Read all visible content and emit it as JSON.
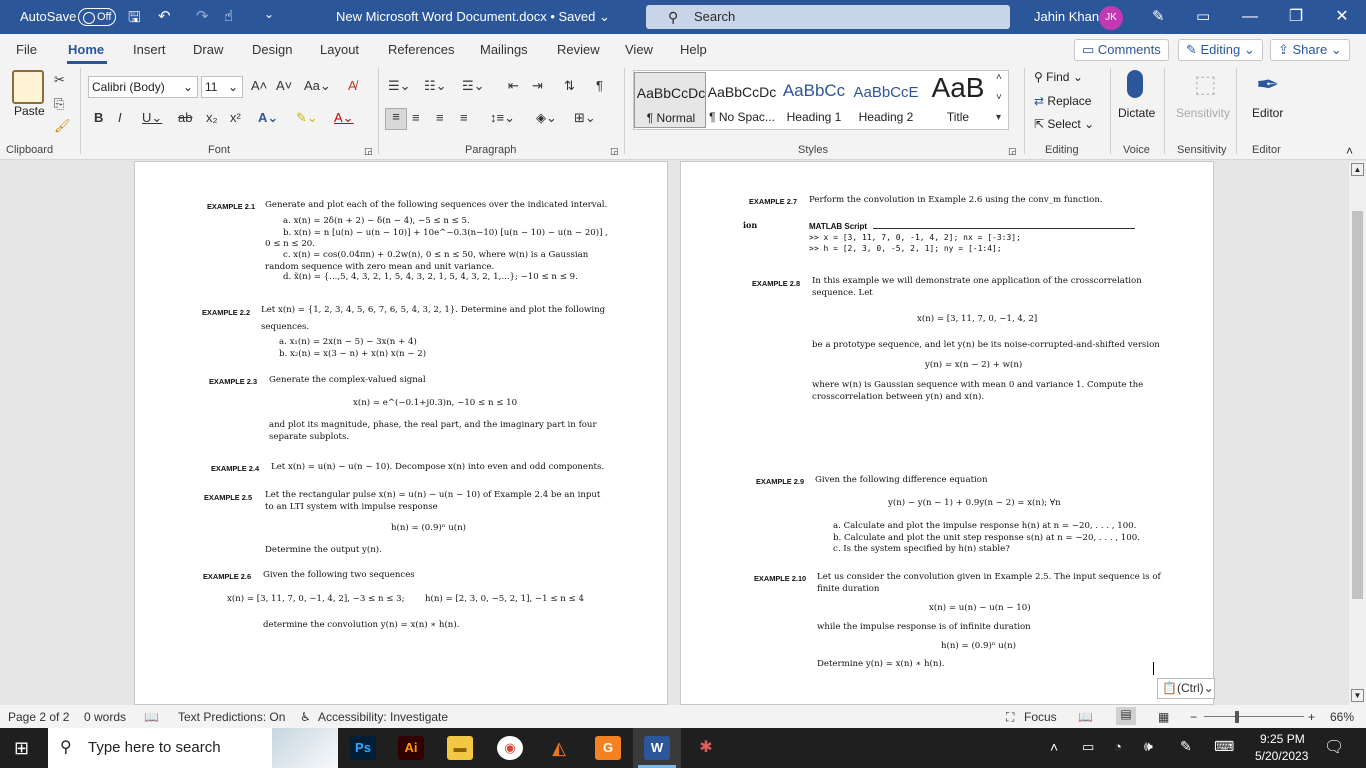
{
  "titlebar": {
    "autosave": "AutoSave",
    "toggle": "Off",
    "doc_title": "New Microsoft Word Document.docx • Saved",
    "search": "Search",
    "user": "Jahin Khan",
    "initials": "JK"
  },
  "menu": {
    "tabs": [
      "File",
      "Home",
      "Insert",
      "Draw",
      "Design",
      "Layout",
      "References",
      "Mailings",
      "Review",
      "View",
      "Help"
    ],
    "comments": "Comments",
    "editing": "Editing",
    "share": "Share"
  },
  "ribbon": {
    "paste": "Paste",
    "font_name": "Calibri (Body)",
    "font_size": "11",
    "styles": [
      {
        "sample": "AaBbCcDc",
        "name": "¶ Normal"
      },
      {
        "sample": "AaBbCcDc",
        "name": "¶ No Spac..."
      },
      {
        "sample": "AaBbCc",
        "name": "Heading 1"
      },
      {
        "sample": "AaBbCcE",
        "name": "Heading 2"
      },
      {
        "sample": "AaB",
        "name": "Title"
      }
    ],
    "find": "Find",
    "replace": "Replace",
    "select": "Select",
    "dictate": "Dictate",
    "sensitivity": "Sensitivity",
    "editor": "Editor",
    "groups": {
      "clipboard": "Clipboard",
      "font": "Font",
      "paragraph": "Paragraph",
      "styles": "Styles",
      "editing": "Editing",
      "voice": "Voice",
      "sensitivity": "Sensitivity",
      "editor": "Editor"
    }
  },
  "page1": {
    "ex21": {
      "label": "EXAMPLE 2.1",
      "text": "Generate and plot each of the following sequences over the indicated interval.",
      "a": "a.  x(n) = 2δ(n + 2) − δ(n − 4),   −5 ≤ n ≤ 5.",
      "b": "b.  x(n) = n [u(n) − u(n − 10)] + 10e^−0.3(n−10) [u(n − 10) − u(n − 20)] ,",
      "b2": "0 ≤ n ≤ 20.",
      "c": "c.  x(n) = cos(0.04πn) + 0.2w(n),  0 ≤ n ≤ 50,  where w(n) is a Gaussian",
      "c2": "random sequence with zero mean and unit variance.",
      "d": "d.  x̃(n) = {...,5, 4, 3, 2, 1, 5, 4, 3, 2, 1, 5, 4, 3, 2, 1,...};  −10 ≤ n ≤ 9."
    },
    "ex22": {
      "label": "EXAMPLE 2.2",
      "text": "Let x(n) = {1, 2, 3, 4, 5, 6, 7, 6, 5, 4, 3, 2, 1}.  Determine and plot the following",
      "text2": "sequences.",
      "a": "a.  x₁(n) = 2x(n − 5) − 3x(n + 4)",
      "b": "b.  x₂(n) = x(3 − n) + x(n) x(n − 2)"
    },
    "ex23": {
      "label": "EXAMPLE 2.3",
      "text": "Generate the complex-valued signal",
      "eq": "x(n) = e^(−0.1+j0.3)n,   −10 ≤ n ≤ 10",
      "t2": "and plot its magnitude, phase, the real part, and the imaginary part in four",
      "t3": "separate subplots."
    },
    "ex24": {
      "label": "EXAMPLE 2.4",
      "text": "Let x(n) = u(n) − u(n − 10).  Decompose x(n) into even and odd components."
    },
    "ex25": {
      "label": "EXAMPLE 2.5",
      "text": "Let the rectangular pulse x(n) = u(n) − u(n − 10) of Example 2.4 be an input",
      "text2": "to an LTI system with impulse response",
      "eq": "h(n) = (0.9)ⁿ u(n)",
      "t3": "Determine the output y(n)."
    },
    "ex26": {
      "label": "EXAMPLE 2.6",
      "text": "Given the following two sequences",
      "eq1": "x(n) = [3, 11, 7, 0, −1, 4, 2],   −3 ≤ n ≤ 3;",
      "eq2": "h(n) = [2, 3, 0, −5, 2, 1],   −1 ≤ n ≤ 4",
      "t3": "determine the convolution y(n) = x(n) ∗ h(n)."
    }
  },
  "page2": {
    "ex27": {
      "label": "EXAMPLE 2.7",
      "text": "Perform the convolution in Example 2.6 using the conv_m function.",
      "side": "ion",
      "script": "MATLAB Script",
      "l1": ">> x = [3, 11, 7, 0, -1, 4, 2]; nx = [-3:3];",
      "l2": ">> h = [2, 3, 0, -5, 2, 1]; ny = [-1:4];"
    },
    "ex28": {
      "label": "EXAMPLE 2.8",
      "text": "In this example we will demonstrate one application of the crosscorrelation",
      "text2": "sequence. Let",
      "eq": "x(n) = [3, 11, 7, 0, −1, 4, 2]",
      "t3": "be a prototype sequence, and let y(n) be its noise-corrupted-and-shifted version",
      "eq2": "y(n) = x(n − 2) + w(n)",
      "t4": "where w(n) is Gaussian sequence with mean 0 and variance 1.  Compute the",
      "t5": "crosscorrelation between y(n) and x(n)."
    },
    "ex29": {
      "label": "EXAMPLE 2.9",
      "text": "Given the following difference equation",
      "eq": "y(n) − y(n − 1) + 0.9y(n − 2) = x(n);   ∀n",
      "a": "a.  Calculate and plot the impulse response h(n) at n = −20, . . . , 100.",
      "b": "b.  Calculate and plot the unit step response s(n) at n = −20, . . . , 100.",
      "c": "c.  Is the system specified by h(n) stable?"
    },
    "ex210": {
      "label": "EXAMPLE 2.10",
      "text": "Let us consider the convolution given in Example 2.5.  The input sequence is of",
      "text2": "finite duration",
      "eq": "x(n) = u(n) − u(n − 10)",
      "t3": "while the impulse response is of infinite duration",
      "eq2": "h(n) = (0.9)ⁿ u(n)",
      "t4": "Determine y(n) = x(n) ∗ h(n)."
    }
  },
  "paste_options": "(Ctrl)",
  "status": {
    "page": "Page 2 of 2",
    "words": "0 words",
    "predictions": "Text Predictions: On",
    "accessibility": "Accessibility: Investigate",
    "focus": "Focus",
    "zoom": "66%"
  },
  "taskbar": {
    "search": "Type here to search",
    "time": "9:25 PM",
    "date": "5/20/2023"
  },
  "colors": {
    "word_blue": "#2b579a"
  }
}
